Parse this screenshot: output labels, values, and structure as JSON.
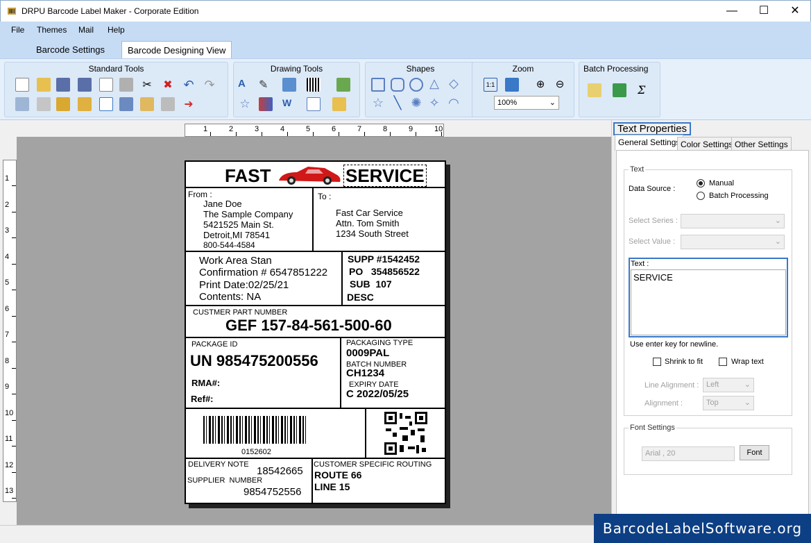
{
  "window": {
    "title": "DRPU Barcode Label Maker - Corporate Edition",
    "minimize": "—",
    "maximize": "☐",
    "close": "✕"
  },
  "menu": [
    "File",
    "Themes",
    "Mail",
    "Help"
  ],
  "tabs": [
    "Barcode Settings",
    "Barcode Designing View"
  ],
  "ribbon": {
    "standard_tools": "Standard Tools",
    "drawing_tools": "Drawing Tools",
    "shapes": "Shapes",
    "zoom": "Zoom",
    "zoom_value": "100%",
    "batch_processing": "Batch Processing"
  },
  "rulers": {
    "top": [
      "1",
      "2",
      "3",
      "4",
      "5",
      "6",
      "7",
      "8",
      "9",
      "10"
    ],
    "left": [
      "1",
      "2",
      "3",
      "4",
      "5",
      "6",
      "7",
      "8",
      "9",
      "10",
      "11",
      "12",
      "13"
    ]
  },
  "label": {
    "header_left": "FAST",
    "header_right": "SERVICE",
    "from_label": "From :",
    "from_lines": [
      "Jane Doe",
      "The Sample Company",
      "5421525 Main St.",
      "Detroit,MI 78541",
      "800-544-4584"
    ],
    "to_label": "To :",
    "to_lines": [
      "Fast Car Service",
      "Attn. Tom Smith",
      "1234 South Street"
    ],
    "work_lines": [
      "Work Area Stan",
      "Confirmation # 6547851222",
      "Print Date:02/25/21",
      "Contents: NA"
    ],
    "supp": "SUPP #1542452",
    "po": "PO   354856522",
    "sub": "SUB  107",
    "desc": "DESC",
    "part_label": "CUSTMER PART NUMBER",
    "part_value": "GEF 157-84-561-500-60",
    "package_id_label": "PACKAGE ID",
    "package_id": "UN 985475200556",
    "rma": "RMA#:",
    "ref": "Ref#:",
    "packaging_type_label": "PACKAGING TYPE",
    "packaging_type": "0009PAL",
    "batch_label": "BATCH NUMBER",
    "batch_value": "CH1234",
    "expiry_label": "EXPIRY DATE",
    "expiry_value": "C 2022/05/25",
    "barcode_text": "0152602",
    "delivery_note_label": "DELIVERY NOTE",
    "delivery_note_value": "18542665",
    "supplier_label": "SUPPLIER  NUMBER",
    "supplier_value": "9854752556",
    "routing_label": "CUSTOMER SPECIFIC ROUTING",
    "route": "ROUTE 66",
    "line": "LINE 15"
  },
  "panel": {
    "title": "Text Properties",
    "tabs": [
      "General Settings",
      "Color Settings",
      "Other Settings"
    ],
    "text_group": "Text",
    "data_source_label": "Data Source :",
    "manual": "Manual",
    "batch_processing": "Batch Processing",
    "select_series": "Select Series :",
    "select_value": "Select Value :",
    "text_label": "Text :",
    "text_value": "SERVICE",
    "hint": "Use enter key for newline.",
    "shrink": "Shrink to fit",
    "wrap": "Wrap text",
    "line_alignment_label": "Line Alignment :",
    "line_alignment": "Left",
    "alignment_label": "Alignment :",
    "alignment": "Top",
    "font_group": "Font Settings",
    "font_value": "Arial , 20",
    "font_button": "Font"
  },
  "watermark": "BarcodeLabelSoftware.org"
}
